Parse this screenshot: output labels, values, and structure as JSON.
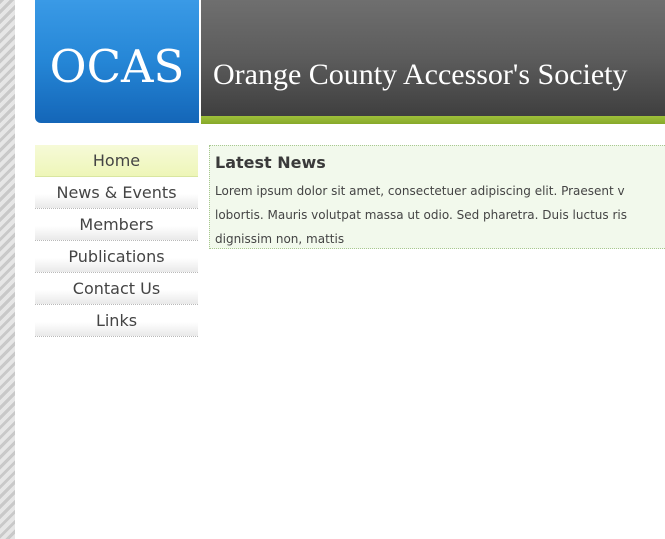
{
  "logo": {
    "text": "OCAS"
  },
  "header": {
    "title": "Orange County Accessor's Society"
  },
  "nav": {
    "items": [
      {
        "label": "Home",
        "active": true
      },
      {
        "label": "News & Events",
        "active": false
      },
      {
        "label": "Members",
        "active": false
      },
      {
        "label": "Publications",
        "active": false
      },
      {
        "label": "Contact Us",
        "active": false
      },
      {
        "label": "Links",
        "active": false
      }
    ]
  },
  "news": {
    "heading": "Latest News",
    "lines": [
      "Lorem ipsum dolor sit amet, consectetuer adipiscing elit. Praesent v",
      "lobortis. Mauris volutpat massa ut odio. Sed pharetra. Duis luctus ris",
      "dignissim non, mattis"
    ]
  },
  "colors": {
    "logo_blue": "#2586d6",
    "banner_gray": "#5c5c5c",
    "accent_green": "#94b634",
    "nav_active": "#eef6b8",
    "news_bg": "#f2f9ec"
  }
}
